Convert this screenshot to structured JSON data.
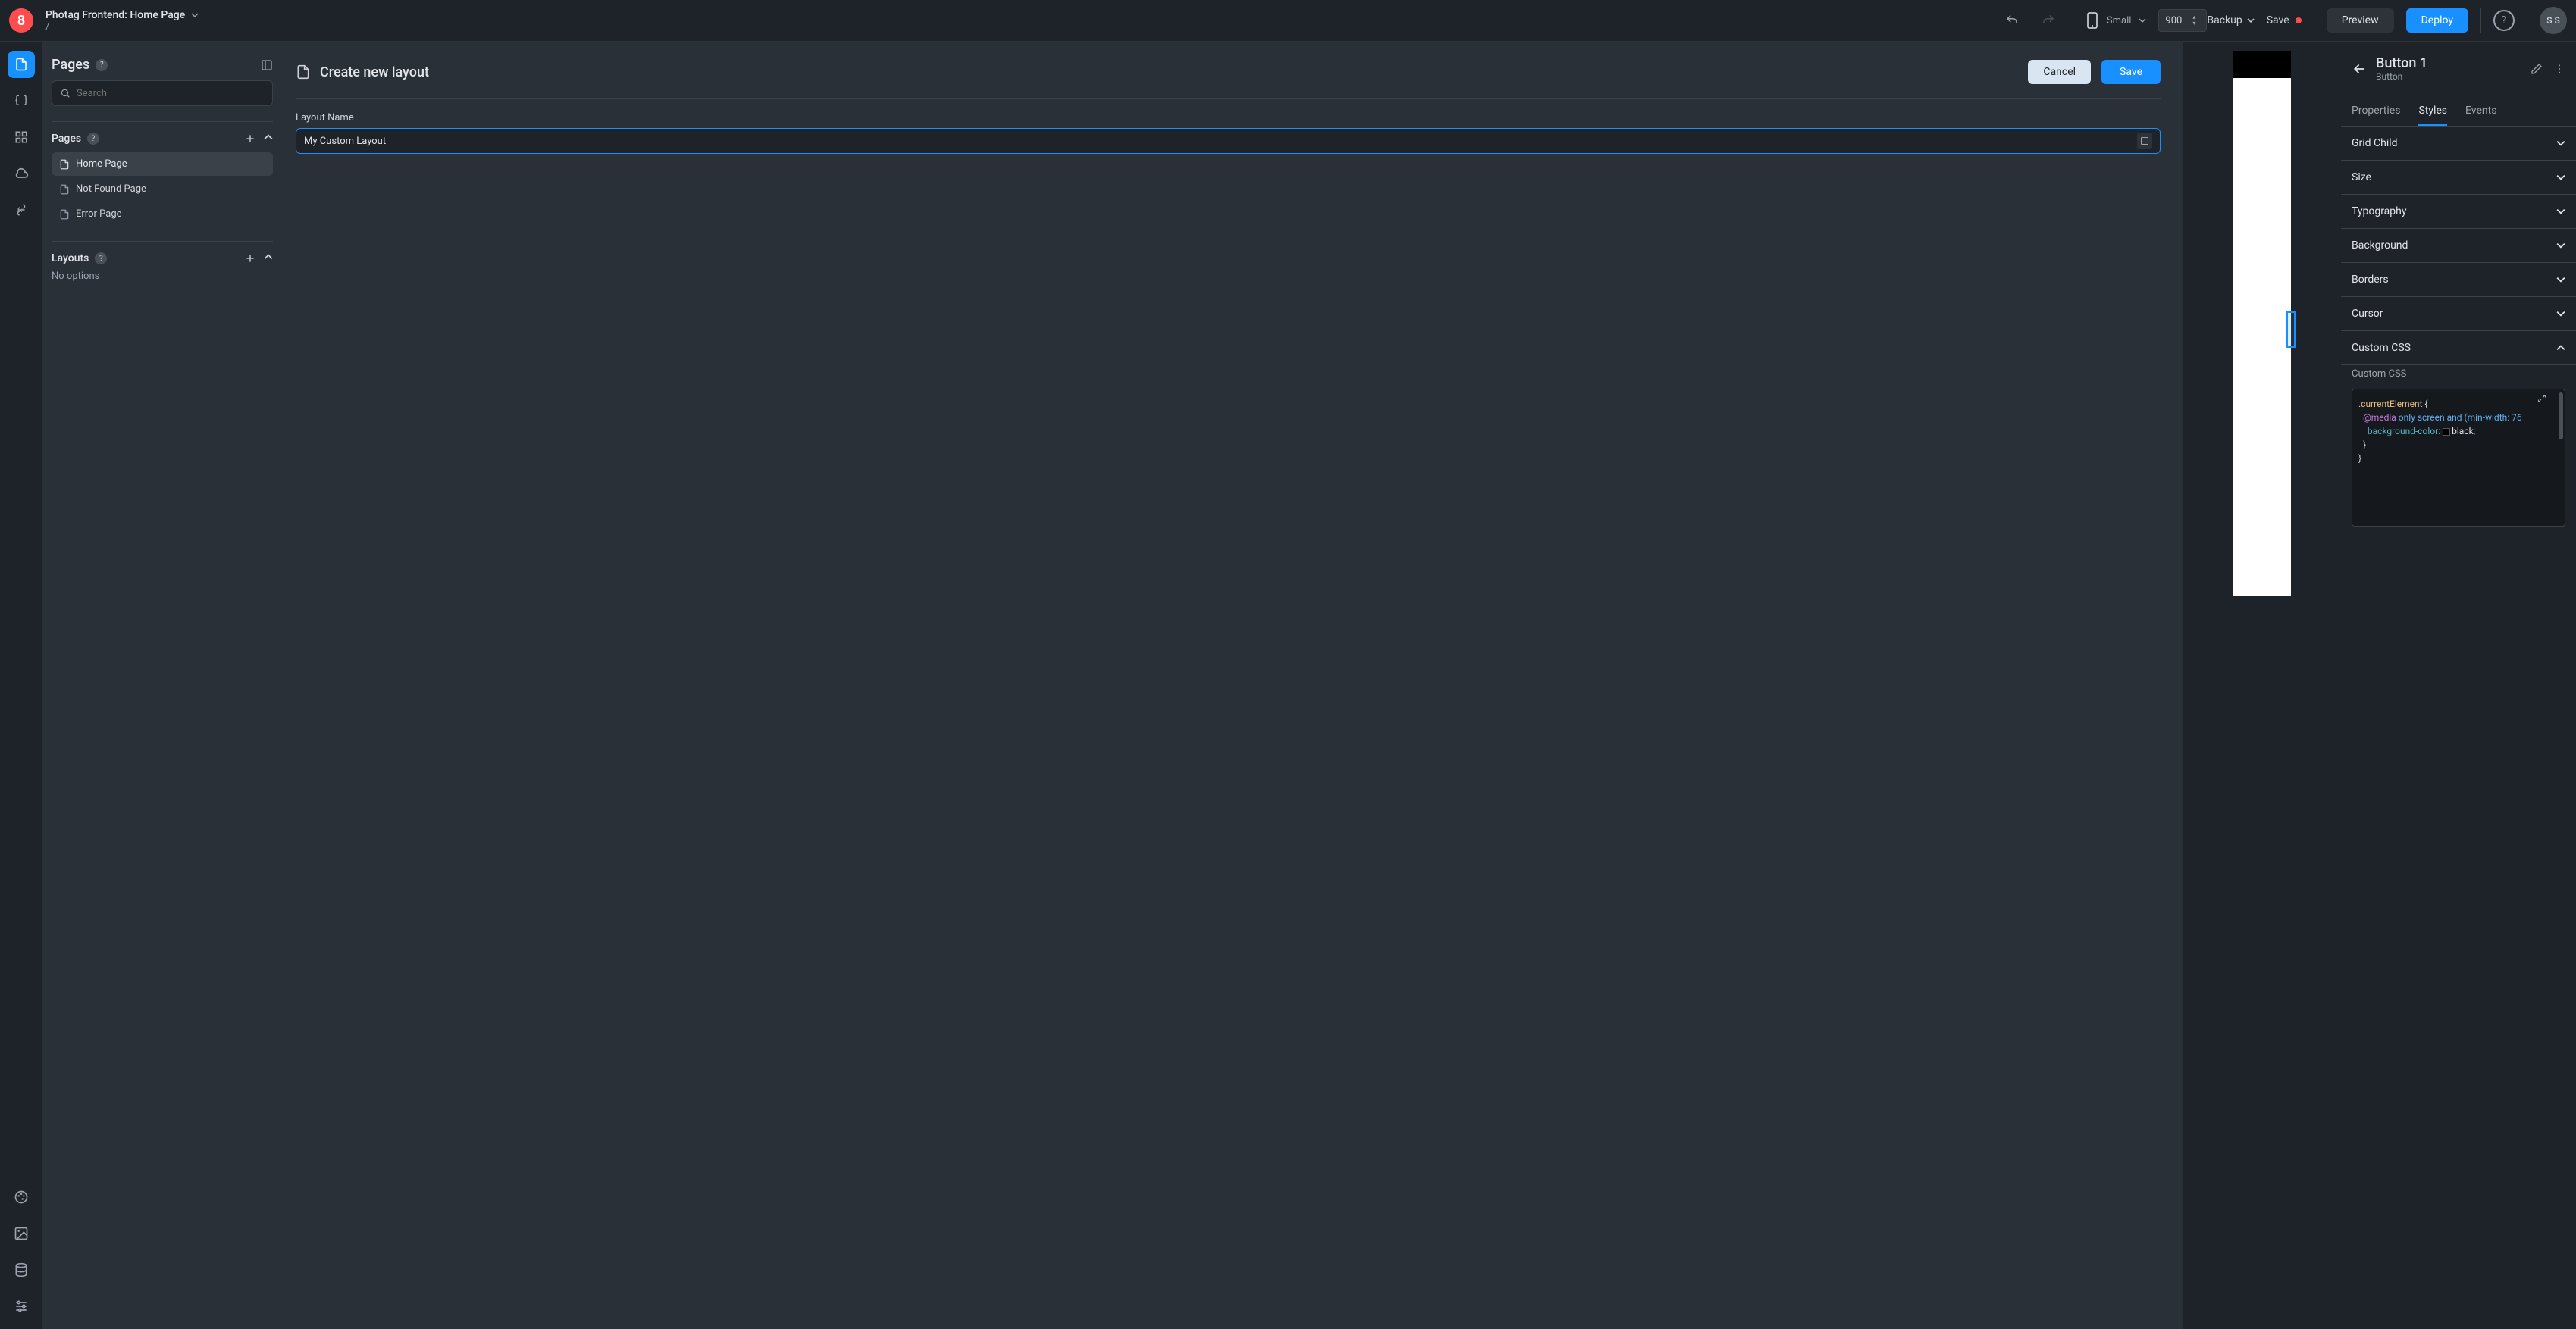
{
  "header": {
    "logo_text": "8",
    "page_title": "Photag Frontend: Home Page",
    "page_subtitle": "/",
    "device_label": "Small",
    "width_value": "900",
    "backup": "Backup",
    "save": "Save",
    "preview": "Preview",
    "deploy": "Deploy",
    "help": "?",
    "avatar": "S S"
  },
  "pages_panel": {
    "title": "Pages",
    "search_placeholder": "Search",
    "pages_section": "Pages",
    "layouts_section": "Layouts",
    "no_options": "No options",
    "items": [
      {
        "label": "Home Page"
      },
      {
        "label": "Not Found Page"
      },
      {
        "label": "Error Page"
      }
    ]
  },
  "form": {
    "title": "Create new layout",
    "cancel": "Cancel",
    "save": "Save",
    "field_label": "Layout Name",
    "layout_name": "My Custom Layout"
  },
  "inspector": {
    "title": "Button 1",
    "subtitle": "Button",
    "tabs": {
      "properties": "Properties",
      "styles": "Styles",
      "events": "Events"
    },
    "sections": {
      "grid_child": "Grid Child",
      "size": "Size",
      "typography": "Typography",
      "background": "Background",
      "borders": "Borders",
      "cursor": "Cursor",
      "custom_css": "Custom CSS"
    },
    "css_label": "Custom CSS",
    "code": {
      "selector": ".currentElement",
      "media_at": "@media",
      "media_body": " only screen and (min-width: 76",
      "prop": "background-color",
      "val": "black"
    }
  }
}
